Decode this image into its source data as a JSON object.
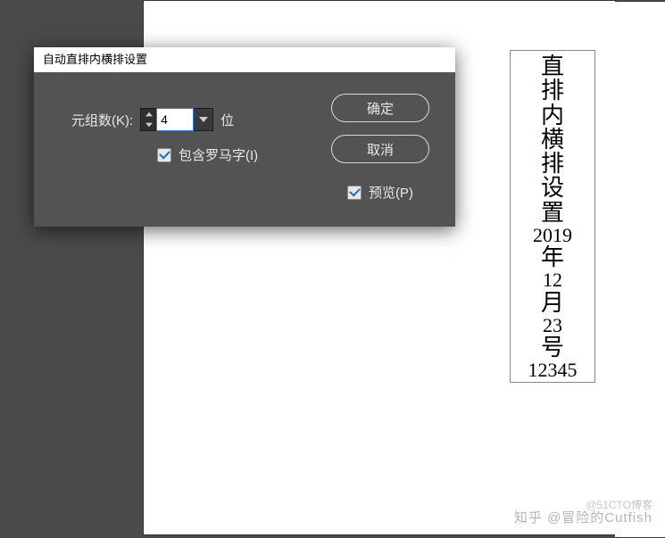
{
  "dialog": {
    "title": "自动直排内横排设置",
    "label_groups": "元组数(K):",
    "value_groups": "4",
    "unit_groups": "位",
    "checkbox_roman": "包含罗马字(I)",
    "checkbox_roman_checked": true,
    "ok": "确定",
    "cancel": "取消",
    "preview": "预览(P)",
    "preview_checked": true
  },
  "document": {
    "vertical_text": [
      "直",
      "排",
      "内",
      "横",
      "排",
      "设",
      "置",
      "2019",
      "年",
      "12",
      "月",
      "23",
      "号",
      "12345"
    ]
  },
  "watermark": {
    "line1": "知乎 @冒险的Cutfish",
    "line2": "@51CTO博客"
  }
}
